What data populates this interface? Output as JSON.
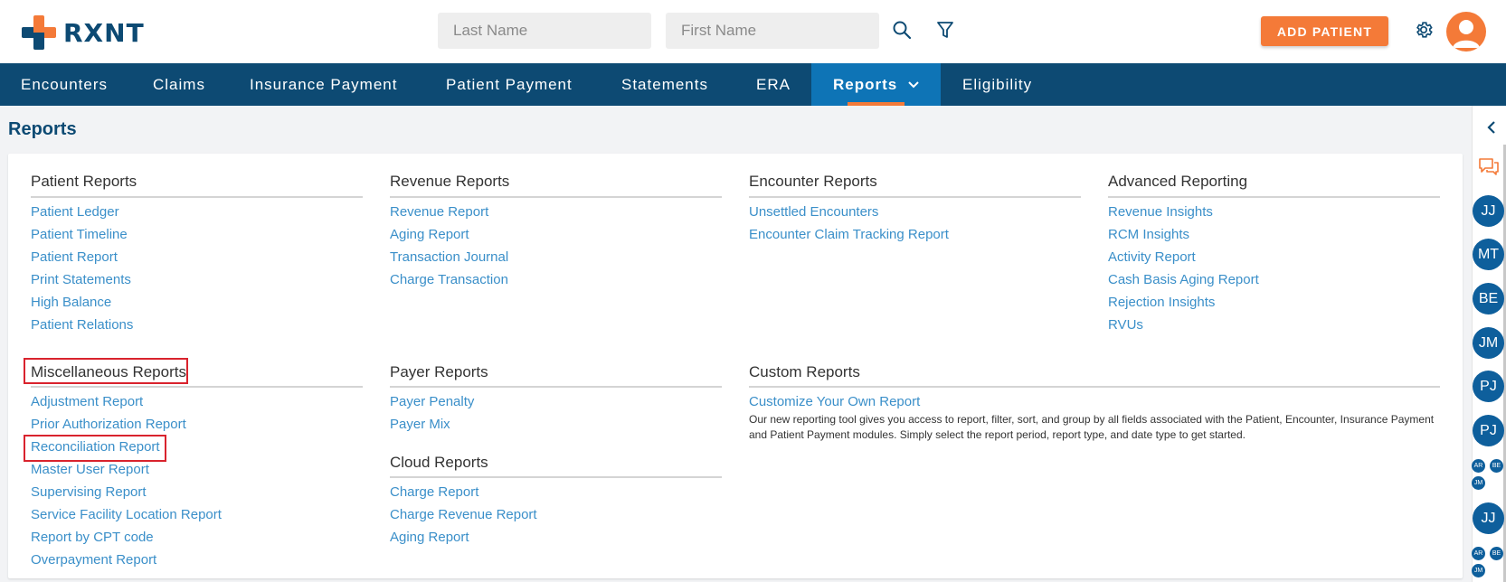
{
  "header": {
    "logo_text": "RXNT",
    "last_name_placeholder": "Last Name",
    "first_name_placeholder": "First Name",
    "add_patient_label": "ADD PATIENT"
  },
  "nav": {
    "items": [
      "Encounters",
      "Claims",
      "Insurance Payment",
      "Patient Payment",
      "Statements",
      "ERA",
      "Reports",
      "Eligibility"
    ],
    "active": "Reports"
  },
  "page": {
    "title": "Reports"
  },
  "sections": {
    "patient": {
      "title": "Patient Reports",
      "links": [
        "Patient Ledger",
        "Patient Timeline",
        "Patient Report",
        "Print Statements",
        "High Balance",
        "Patient Relations"
      ]
    },
    "revenue": {
      "title": "Revenue Reports",
      "links": [
        "Revenue Report",
        "Aging Report",
        "Transaction Journal",
        "Charge Transaction"
      ]
    },
    "encounter": {
      "title": "Encounter Reports",
      "links": [
        "Unsettled Encounters",
        "Encounter Claim Tracking Report"
      ]
    },
    "advanced": {
      "title": "Advanced Reporting",
      "links": [
        "Revenue Insights",
        "RCM Insights",
        "Activity Report",
        "Cash Basis Aging Report",
        "Rejection Insights",
        "RVUs"
      ]
    },
    "misc": {
      "title": "Miscellaneous Reports",
      "links": [
        "Adjustment Report",
        "Prior Authorization Report",
        "Reconciliation Report",
        "Master User Report",
        "Supervising Report",
        "Service Facility Location Report",
        "Report by CPT code",
        "Overpayment Report"
      ]
    },
    "payer": {
      "title": "Payer Reports",
      "links": [
        "Payer Penalty",
        "Payer Mix"
      ]
    },
    "cloud": {
      "title": "Cloud Reports",
      "links": [
        "Charge Report",
        "Charge Revenue Report",
        "Aging Report"
      ]
    },
    "custom": {
      "title": "Custom Reports",
      "links": [
        "Customize Your Own Report"
      ],
      "description_line1": "Our new reporting tool gives you access to report, filter, sort, and group by all fields associated with the Patient, Encounter, Insurance Payment",
      "description_line2": "and Patient Payment modules. Simply select the report period, report type, and date type to get started."
    }
  },
  "rail": {
    "bubbles": [
      "JJ",
      "MT",
      "BE",
      "JM",
      "PJ",
      "PJ"
    ],
    "group1": [
      "AR",
      "BE",
      "JM"
    ],
    "bubble_last": "JJ",
    "group2": [
      "AR",
      "BE",
      "JM"
    ]
  },
  "colors": {
    "brand_navy": "#0d4a73",
    "accent_orange": "#f47a38",
    "active_blue": "#0e74b6",
    "link_blue": "#3a8fc9",
    "highlight_red": "#d9232d"
  }
}
